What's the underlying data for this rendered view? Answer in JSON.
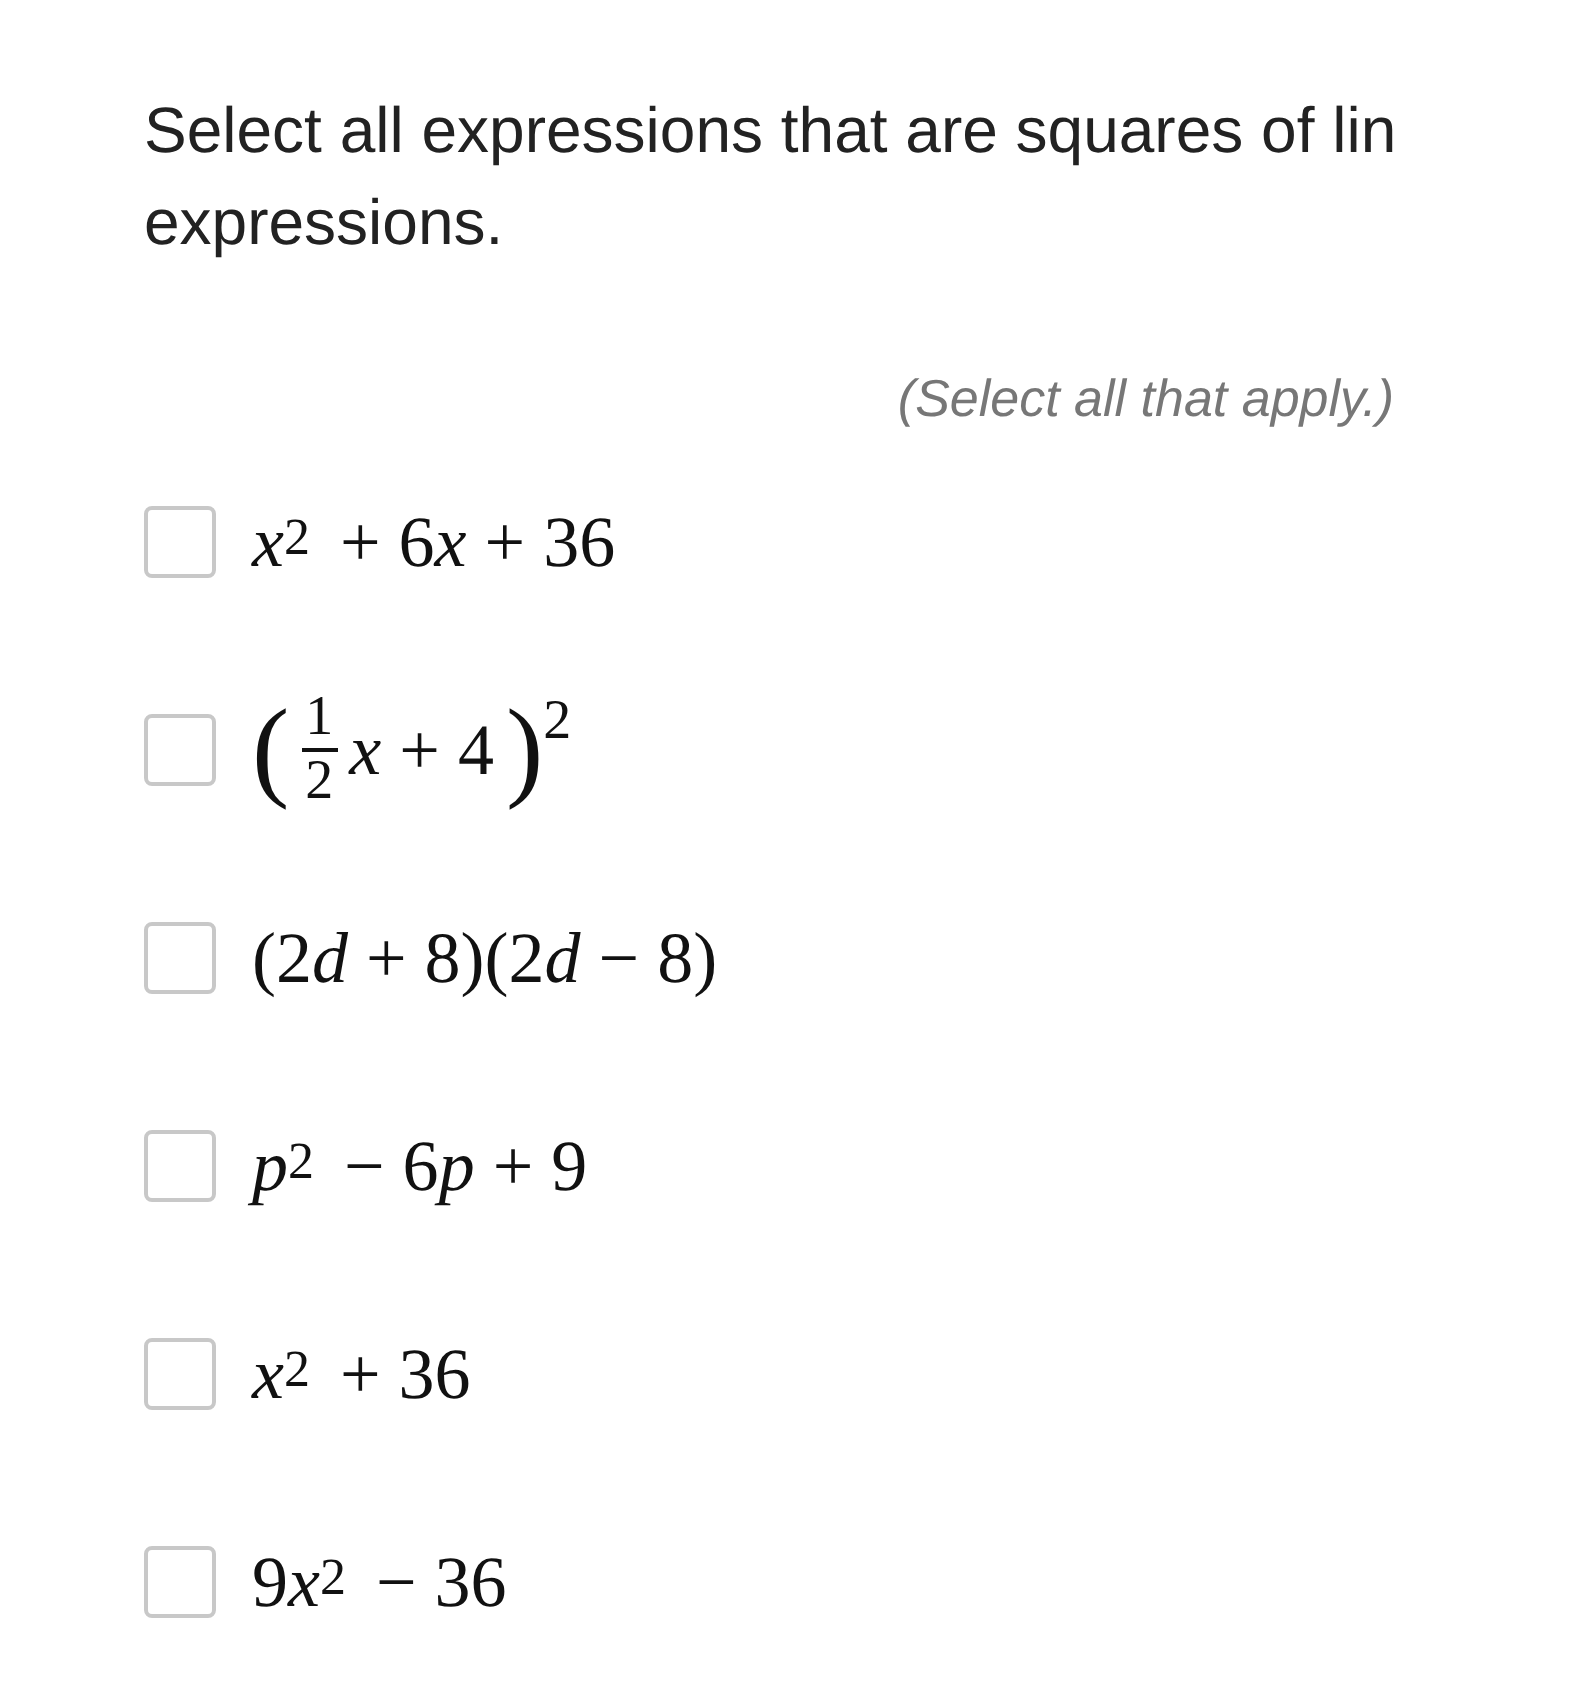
{
  "prompt_lines": [
    "Select all expressions that are squares of lin",
    "expressions."
  ],
  "instruction": "(Select all that apply.)",
  "options": [
    {
      "kind": "inline",
      "checked": false,
      "parts": [
        {
          "kind": "var",
          "text": "x"
        },
        {
          "kind": "sup",
          "text": "2"
        },
        {
          "kind": "text",
          "text": " + 6"
        },
        {
          "kind": "var",
          "text": "x"
        },
        {
          "kind": "text",
          "text": " + 36"
        }
      ]
    },
    {
      "kind": "fraction",
      "checked": false,
      "open": "(",
      "numerator": "1",
      "denominator": "2",
      "parts": [
        {
          "kind": "var",
          "text": "x"
        },
        {
          "kind": "text",
          "text": " + 4"
        }
      ],
      "close": ")",
      "exponent": "2"
    },
    {
      "kind": "inline",
      "checked": false,
      "parts": [
        {
          "kind": "text",
          "text": "(2"
        },
        {
          "kind": "var",
          "text": "d"
        },
        {
          "kind": "text",
          "text": " + 8)(2"
        },
        {
          "kind": "var",
          "text": "d"
        },
        {
          "kind": "text",
          "text": " − 8)"
        }
      ]
    },
    {
      "kind": "inline",
      "checked": false,
      "parts": [
        {
          "kind": "var",
          "text": "p"
        },
        {
          "kind": "sup",
          "text": "2"
        },
        {
          "kind": "text",
          "text": " − 6"
        },
        {
          "kind": "var",
          "text": "p"
        },
        {
          "kind": "text",
          "text": " + 9"
        }
      ]
    },
    {
      "kind": "inline",
      "checked": false,
      "parts": [
        {
          "kind": "var",
          "text": "x"
        },
        {
          "kind": "sup",
          "text": "2"
        },
        {
          "kind": "text",
          "text": " + 36"
        }
      ]
    },
    {
      "kind": "inline",
      "checked": false,
      "parts": [
        {
          "kind": "text",
          "text": "9"
        },
        {
          "kind": "var",
          "text": "x"
        },
        {
          "kind": "sup",
          "text": "2"
        },
        {
          "kind": "text",
          "text": " − 36"
        }
      ]
    }
  ]
}
